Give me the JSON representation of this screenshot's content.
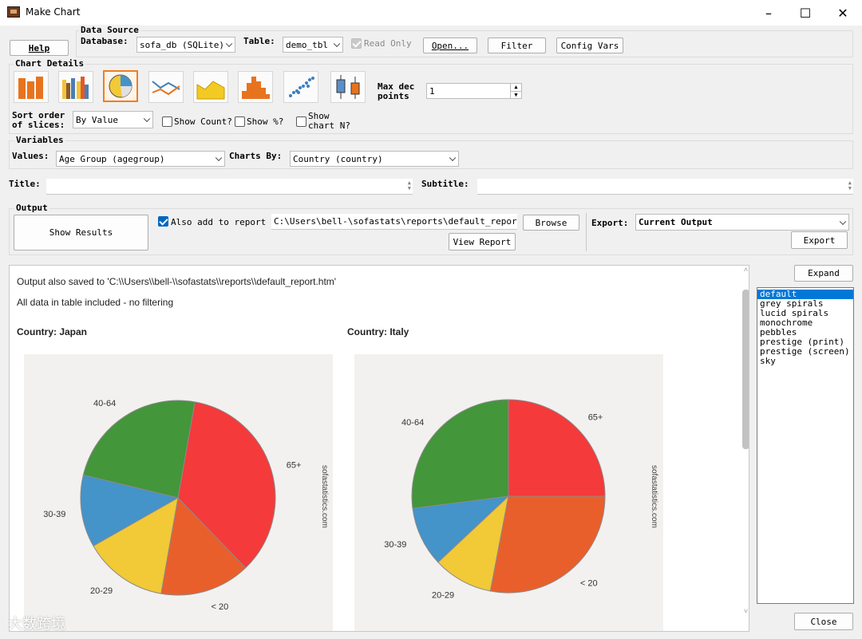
{
  "window": {
    "title": "Make Chart",
    "minimize": "–",
    "maximize": "☐",
    "close": "✕"
  },
  "top": {
    "help": "Help"
  },
  "data_source": {
    "group": "Data Source",
    "database_label": "Database:",
    "database_value": "sofa_db (SQLite)",
    "table_label": "Table:",
    "table_value": "demo_tbl",
    "read_only": "Read Only",
    "open": "Open...",
    "filter": "Filter",
    "config_vars": "Config Vars"
  },
  "chart_details": {
    "group": "Chart Details",
    "chart_types": [
      {
        "name": "simple-bar-chart-icon"
      },
      {
        "name": "clustered-bar-chart-icon"
      },
      {
        "name": "pie-chart-icon",
        "selected": true
      },
      {
        "name": "line-chart-icon"
      },
      {
        "name": "area-chart-icon"
      },
      {
        "name": "histogram-icon"
      },
      {
        "name": "scatterplot-icon"
      },
      {
        "name": "boxplot-icon"
      }
    ],
    "max_dec_label": "Max dec\npoints",
    "max_dec_value": "1",
    "sort_label": "Sort order\nof slices:",
    "sort_value": "By Value",
    "show_count": "Show Count?",
    "show_pct": "Show %?",
    "show_chart_n": "Show\nchart N?"
  },
  "variables": {
    "group": "Variables",
    "values_label": "Values:",
    "values_value": "Age Group (agegroup)",
    "charts_by_label": "Charts By:",
    "charts_by_value": "Country (country)"
  },
  "titles": {
    "title_label": "Title:",
    "subtitle_label": "Subtitle:"
  },
  "output": {
    "group": "Output",
    "show_results": "Show Results",
    "also_add": "Also add to report",
    "report_path": "C:\\Users\\bell-\\sofastats\\reports\\default_report.ht",
    "browse": "Browse",
    "view_report": "View Report",
    "export_label": "Export:",
    "export_value": "Current Output",
    "export_btn": "Export"
  },
  "results": {
    "line1": "Output also saved to 'C:\\\\Users\\\\bell-\\\\sofastats\\\\reports\\\\default_report.htm'",
    "line2": "All data in table included - no filtering",
    "watermark": "sofastatistics.com"
  },
  "side": {
    "expand": "Expand",
    "close": "Close",
    "styles": [
      "default",
      "grey spirals",
      "lucid spirals",
      "monochrome",
      "pebbles",
      "prestige (print)",
      "prestige (screen)",
      "sky"
    ]
  },
  "footer_watermark": "大数跨境",
  "colors": {
    "accent": "#0078d7",
    "selected_chart": "#ef7d22"
  },
  "chart_data": [
    {
      "type": "pie",
      "title": "Country: Japan",
      "categories": [
        "65+",
        "< 20",
        "20-29",
        "30-39",
        "40-64"
      ],
      "values": [
        35,
        15,
        14,
        12,
        24
      ],
      "colors": [
        "#f43a3a",
        "#e95f2b",
        "#f2c937",
        "#4493c9",
        "#43963a"
      ]
    },
    {
      "type": "pie",
      "title": "Country: Italy",
      "categories": [
        "65+",
        "< 20",
        "20-29",
        "30-39",
        "40-64"
      ],
      "values": [
        25,
        28,
        10,
        10,
        27
      ],
      "colors": [
        "#f43a3a",
        "#e95f2b",
        "#f2c937",
        "#4493c9",
        "#43963a"
      ]
    }
  ]
}
